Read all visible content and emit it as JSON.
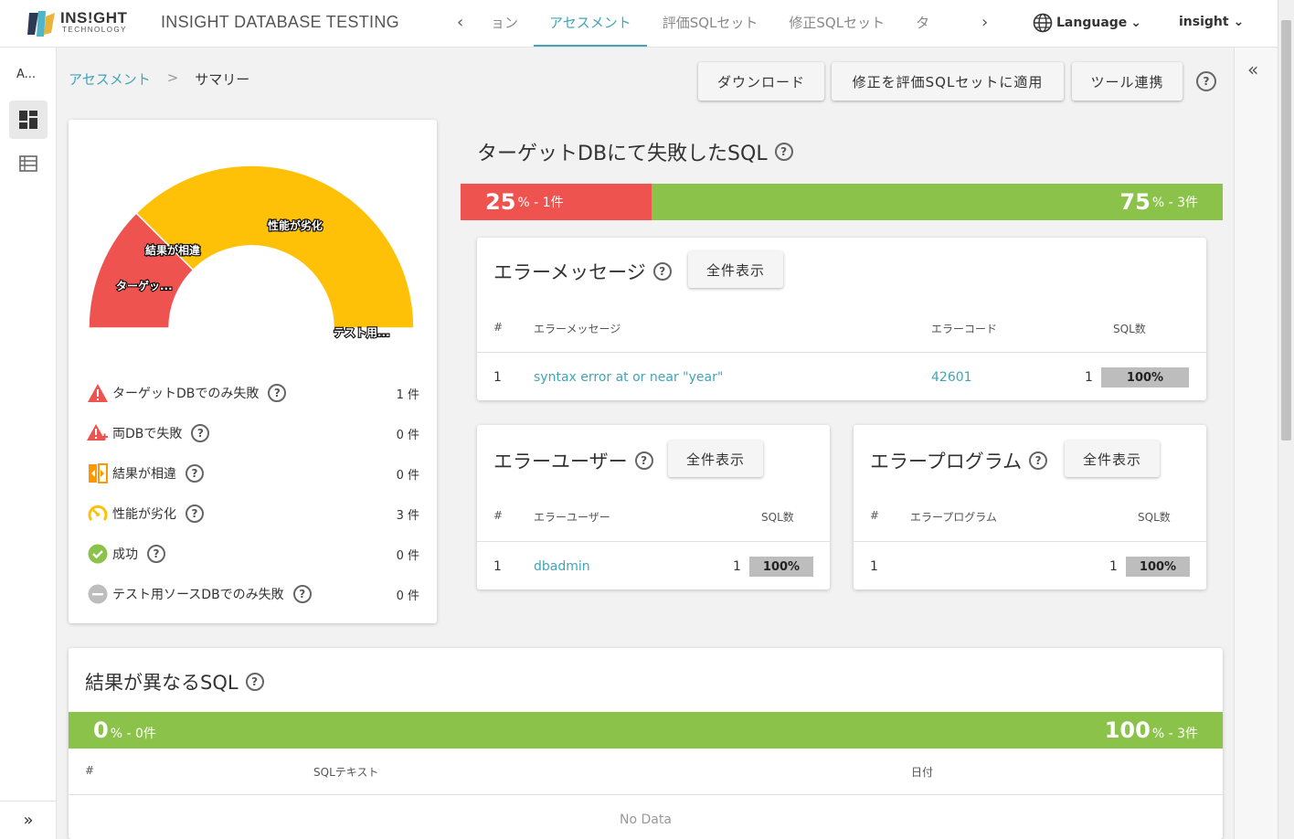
{
  "header": {
    "logo_text": "INS!GHT",
    "logo_sub": "TECHNOLOGY",
    "app_title": "INSIGHT DATABASE TESTING",
    "tabs": [
      {
        "label": "ョン"
      },
      {
        "label": "アセスメント",
        "active": true
      },
      {
        "label": "評価SQLセット"
      },
      {
        "label": "修正SQLセット"
      },
      {
        "label": "タ"
      }
    ],
    "language_label": "Language",
    "user_label": "insight"
  },
  "sidebar": {
    "abbr": "A..."
  },
  "breadcrumb": {
    "parent": "アセスメント",
    "separator": ">",
    "current": "サマリー"
  },
  "toolbar": {
    "download": "ダウンロード",
    "apply": "修正を評価SQLセットに適用",
    "tool": "ツール連携"
  },
  "summary": {
    "gauge_labels": [
      "ターゲッ...",
      "結果が相違",
      "性能が劣化",
      "テスト用..."
    ],
    "legend": [
      {
        "label": "ターゲットDBでのみ失敗",
        "count": "1 件",
        "icon": "warning-icon",
        "color": "#ef5350"
      },
      {
        "label": "両DBで失敗",
        "count": "0 件",
        "icon": "warning-plus-icon",
        "color": "#ef5350"
      },
      {
        "label": "結果が相違",
        "count": "0 件",
        "icon": "compare-icon",
        "color": "#ff9800"
      },
      {
        "label": "性能が劣化",
        "count": "3 件",
        "icon": "speedometer-icon",
        "color": "#ffc107"
      },
      {
        "label": "成功",
        "count": "0 件",
        "icon": "check-circle-icon",
        "color": "#8bc34a"
      },
      {
        "label": "テスト用ソースDBでのみ失敗",
        "count": "0 件",
        "icon": "minus-circle-icon",
        "color": "#bdbdbd"
      }
    ]
  },
  "chart_data": {
    "type": "pie",
    "categories": [
      "ターゲットDBでのみ失敗",
      "両DBで失敗",
      "結果が相違",
      "性能が劣化",
      "成功",
      "テスト用ソースDBでのみ失敗"
    ],
    "values": [
      1,
      0,
      0,
      3,
      0,
      0
    ],
    "colors": [
      "#ef5350",
      "#ef5350",
      "#ff9800",
      "#ffc107",
      "#8bc34a",
      "#bdbdbd"
    ]
  },
  "failed_sql": {
    "title": "ターゲットDBにて失敗したSQL",
    "fail_pct": "25",
    "fail_count": "% - 1件",
    "ok_pct": "75",
    "ok_count": "% - 3件",
    "fail_ratio": 0.25
  },
  "error_messages": {
    "title": "エラーメッセージ",
    "show_all": "全件表示",
    "headers": [
      "#",
      "エラーメッセージ",
      "エラーコード",
      "SQL数"
    ],
    "rows": [
      {
        "num": "1",
        "message": "syntax error at or near \"year\"",
        "code": "42601",
        "count": "1",
        "pct": "100%"
      }
    ]
  },
  "error_users": {
    "title": "エラーユーザー",
    "show_all": "全件表示",
    "headers": [
      "#",
      "エラーユーザー",
      "SQL数"
    ],
    "rows": [
      {
        "num": "1",
        "user": "dbadmin",
        "count": "1",
        "pct": "100%"
      }
    ]
  },
  "error_programs": {
    "title": "エラープログラム",
    "show_all": "全件表示",
    "headers": [
      "#",
      "エラープログラム",
      "SQL数"
    ],
    "rows": [
      {
        "num": "1",
        "program": "",
        "count": "1",
        "pct": "100%"
      }
    ]
  },
  "diff_sql": {
    "title": "結果が異なるSQL",
    "diff_pct": "0",
    "diff_count": "% - 0件",
    "same_pct": "100",
    "same_count": "% - 3件",
    "headers": [
      "#",
      "SQLテキスト",
      "日付"
    ],
    "no_data": "No Data"
  }
}
